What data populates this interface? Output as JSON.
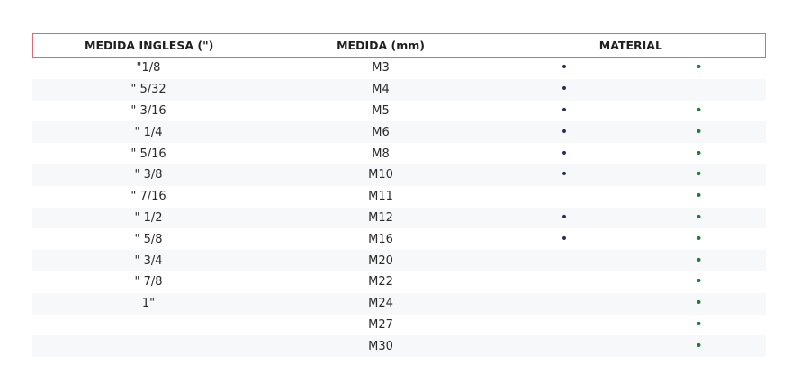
{
  "headers": {
    "inglesa": "MEDIDA INGLESA (\")",
    "mm": "MEDIDA (mm)",
    "material": "MATERIAL"
  },
  "dot_glyph": "•",
  "colors": {
    "header_border": "#d96a78",
    "dot_col1": "#2a2f5a",
    "dot_col2": "#1f7a3c",
    "stripe": "#f7f8fa"
  },
  "rows": [
    {
      "inglesa": "\"1/8",
      "mm": "M3",
      "m1": true,
      "m2": true
    },
    {
      "inglesa": "\" 5/32",
      "mm": "M4",
      "m1": true,
      "m2": false
    },
    {
      "inglesa": "\" 3/16",
      "mm": "M5",
      "m1": true,
      "m2": true
    },
    {
      "inglesa": "\" 1/4",
      "mm": "M6",
      "m1": true,
      "m2": true
    },
    {
      "inglesa": "\" 5/16",
      "mm": "M8",
      "m1": true,
      "m2": true
    },
    {
      "inglesa": "\" 3/8",
      "mm": "M10",
      "m1": true,
      "m2": true
    },
    {
      "inglesa": "\" 7/16",
      "mm": "M11",
      "m1": false,
      "m2": true
    },
    {
      "inglesa": "\" 1/2",
      "mm": "M12",
      "m1": true,
      "m2": true
    },
    {
      "inglesa": "\" 5/8",
      "mm": "M16",
      "m1": true,
      "m2": true
    },
    {
      "inglesa": "\" 3/4",
      "mm": "M20",
      "m1": false,
      "m2": true
    },
    {
      "inglesa": "\" 7/8",
      "mm": "M22",
      "m1": false,
      "m2": true
    },
    {
      "inglesa": "1\"",
      "mm": "M24",
      "m1": false,
      "m2": true
    },
    {
      "inglesa": "",
      "mm": "M27",
      "m1": false,
      "m2": true
    },
    {
      "inglesa": "",
      "mm": "M30",
      "m1": false,
      "m2": true
    }
  ]
}
